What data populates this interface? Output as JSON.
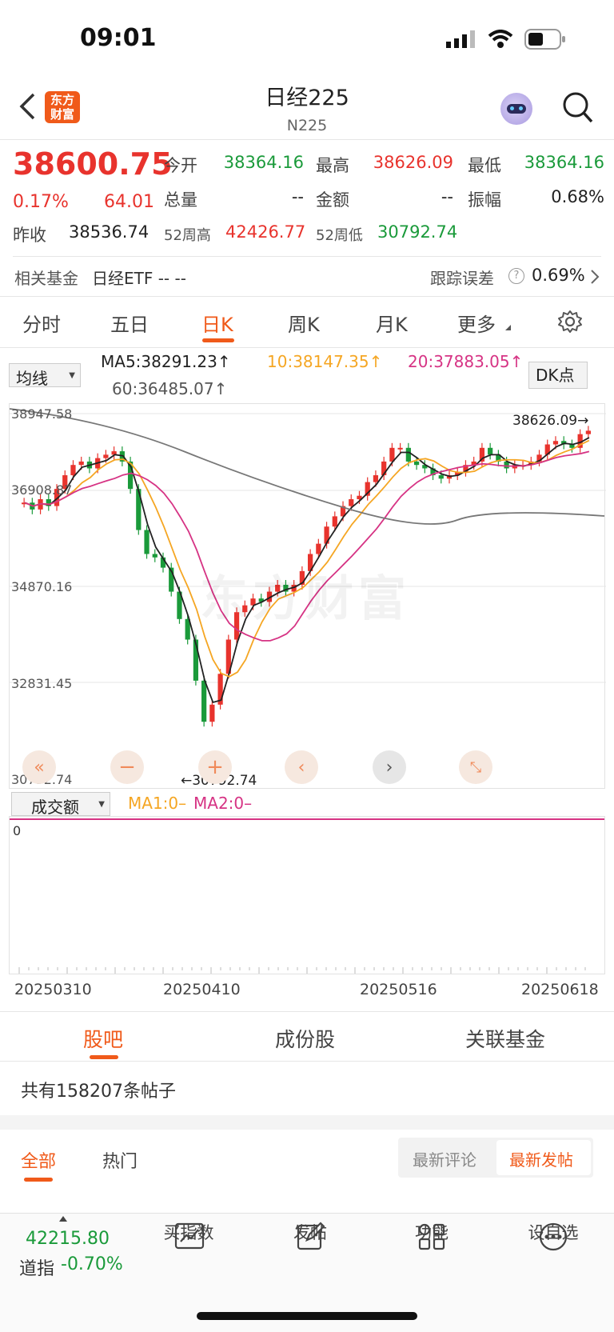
{
  "status": {
    "time": "09:01"
  },
  "header": {
    "title": "日经225",
    "code": "N225",
    "logo_line1": "东方",
    "logo_line2": "财富"
  },
  "quote": {
    "price": "38600.75",
    "pct": "0.17%",
    "change": "64.01",
    "open_label": "今开",
    "open": "38364.16",
    "high_label": "最高",
    "high": "38626.09",
    "low_label": "最低",
    "low": "38364.16",
    "vol_label": "总量",
    "vol": "--",
    "amt_label": "金额",
    "amt": "--",
    "amp_label": "振幅",
    "amp": "0.68%",
    "prev_label": "昨收",
    "prev": "38536.74",
    "w52h_label": "52周高",
    "w52h": "42426.77",
    "w52l_label": "52周低",
    "w52l": "30792.74"
  },
  "fund": {
    "label": "相关基金",
    "value": "日经ETF -- --",
    "track_label": "跟踪误差",
    "track": "0.69%"
  },
  "period_tabs": [
    "分时",
    "五日",
    "日K",
    "周K",
    "月K",
    "更多"
  ],
  "indicator": {
    "select": "均线",
    "ma5": "MA5:38291.23↑",
    "ma10": "10:38147.35↑",
    "ma20": "20:37883.05↑",
    "ma60": "60:36485.07↑",
    "dk": "DK点"
  },
  "axis": {
    "y1": "38947.58",
    "y2": "36908.87",
    "y3": "34870.16",
    "y4": "32831.45",
    "y5": "30792.74",
    "high_mark": "38626.09→",
    "low_mark": "←30792.74",
    "watermark": "东方财富"
  },
  "volume": {
    "select": "成交额",
    "ma1": "MA1:0–",
    "ma2": "MA2:0–",
    "zero": "0"
  },
  "dates": [
    "20250310",
    "20250410",
    "20250516",
    "20250618"
  ],
  "community": {
    "tabs": [
      "股吧",
      "成份股",
      "关联基金"
    ],
    "count_text": "共有158207条帖子",
    "filters": [
      "全部",
      "热门"
    ],
    "sort": [
      "最新评论",
      "最新发帖"
    ]
  },
  "bottom": {
    "index_value": "42215.80",
    "index_name": "道指",
    "index_pct": "-0.70%",
    "nav": [
      "买指数",
      "发帖",
      "功能",
      "设自选"
    ]
  },
  "colors": {
    "up": "#e8332d",
    "down": "#1a9a3a",
    "ma5": "#222222",
    "ma10": "#f5a623",
    "ma20": "#d63384",
    "ma60": "#777777",
    "accent": "#f05a1a"
  }
}
